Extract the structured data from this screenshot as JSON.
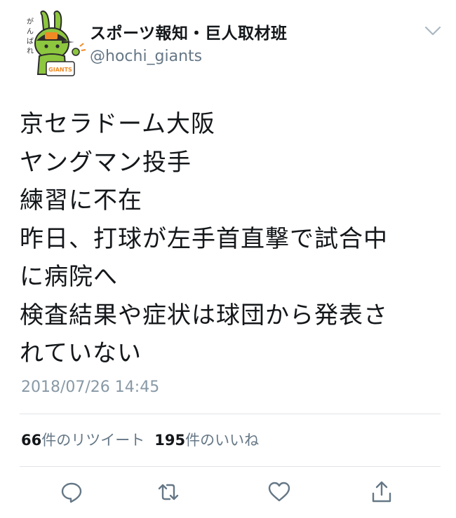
{
  "account": {
    "display_name": "スポーツ報知・巨人取材班",
    "handle": "@hochi_giants",
    "avatar_icon": "mascot-avatar-icon",
    "avatar_lettering": [
      "がんばれ",
      "GIANTS"
    ]
  },
  "tweet": {
    "lines": [
      "京セラドーム大阪",
      "ヤングマン投手",
      "練習に不在",
      "昨日、打球が左手首直撃で試合中",
      "に病院へ",
      "検査結果や症状は球団から発表さ",
      "れていない"
    ],
    "timestamp": "2018/07/26 14:45"
  },
  "stats": {
    "retweets_count": "66",
    "retweets_label": "件のリツイート",
    "likes_count": "195",
    "likes_label": "件のいいね"
  },
  "actions": [
    {
      "name": "reply",
      "icon": "reply-icon"
    },
    {
      "name": "retweet",
      "icon": "retweet-icon"
    },
    {
      "name": "like",
      "icon": "heart-icon"
    },
    {
      "name": "share",
      "icon": "share-icon"
    }
  ],
  "colors": {
    "text": "#14171a",
    "secondary": "#657786",
    "timestamp": "#8899a6",
    "icon": "#657786",
    "divider": "#dfe3e7",
    "mascot_green": "#8dc63f",
    "giants_orange": "#f08a24"
  }
}
